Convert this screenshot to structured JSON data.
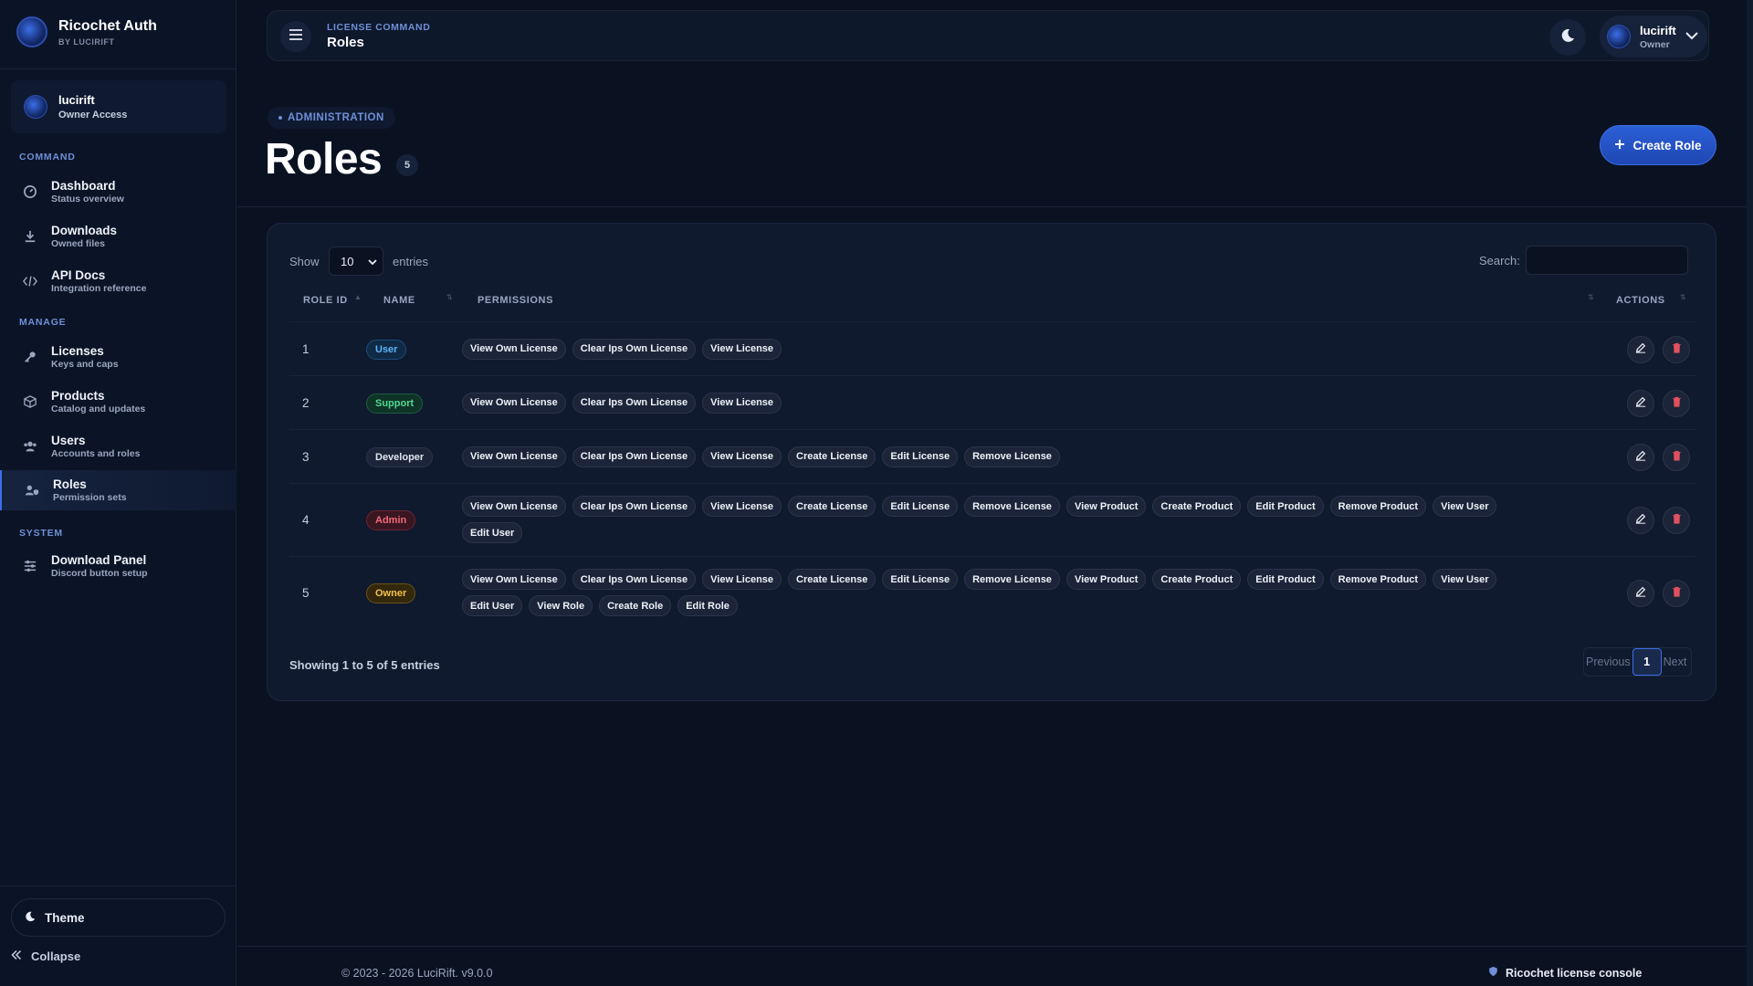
{
  "app": {
    "title": "Ricochet Auth",
    "subtitle": "BY LUCIRIFT"
  },
  "user": {
    "name": "lucirift",
    "access": "Owner Access"
  },
  "sidebar": {
    "sections": [
      {
        "label": "COMMAND"
      },
      {
        "label": "MANAGE"
      },
      {
        "label": "SYSTEM"
      }
    ],
    "items": [
      {
        "title": "Dashboard",
        "sub": "Status overview",
        "icon": "gauge-icon"
      },
      {
        "title": "Downloads",
        "sub": "Owned files",
        "icon": "download-icon"
      },
      {
        "title": "API Docs",
        "sub": "Integration reference",
        "icon": "code-icon"
      },
      {
        "title": "Licenses",
        "sub": "Keys and caps",
        "icon": "key-icon"
      },
      {
        "title": "Products",
        "sub": "Catalog and updates",
        "icon": "box-icon"
      },
      {
        "title": "Users",
        "sub": "Accounts and roles",
        "icon": "users-icon"
      },
      {
        "title": "Roles",
        "sub": "Permission sets",
        "icon": "user-shield-icon"
      },
      {
        "title": "Download Panel",
        "sub": "Discord button setup",
        "icon": "sliders-icon"
      }
    ],
    "theme_label": "Theme",
    "collapse_label": "Collapse"
  },
  "topbar": {
    "breadcrumb_top": "LICENSE COMMAND",
    "breadcrumb_main": "Roles",
    "profile_name": "lucirift",
    "profile_role": "Owner"
  },
  "header": {
    "section_pill": "ADMINISTRATION",
    "title": "Roles",
    "count": "5",
    "create_label": "Create Role"
  },
  "table": {
    "show_label": "Show",
    "page_size": "10",
    "entries_label": "entries",
    "search_label": "Search:",
    "search_value": "",
    "columns": [
      "ROLE ID",
      "NAME",
      "PERMISSIONS",
      "ACTIONS"
    ],
    "rows": [
      {
        "id": "1",
        "name": "User",
        "permissions": [
          "View Own License",
          "Clear Ips Own License",
          "View License"
        ]
      },
      {
        "id": "2",
        "name": "Support",
        "permissions": [
          "View Own License",
          "Clear Ips Own License",
          "View License"
        ]
      },
      {
        "id": "3",
        "name": "Developer",
        "permissions": [
          "View Own License",
          "Clear Ips Own License",
          "View License",
          "Create License",
          "Edit License",
          "Remove License"
        ]
      },
      {
        "id": "4",
        "name": "Admin",
        "permissions": [
          "View Own License",
          "Clear Ips Own License",
          "View License",
          "Create License",
          "Edit License",
          "Remove License",
          "View Product",
          "Create Product",
          "Edit Product",
          "Remove Product",
          "View User",
          "Edit User"
        ]
      },
      {
        "id": "5",
        "name": "Owner",
        "permissions": [
          "View Own License",
          "Clear Ips Own License",
          "View License",
          "Create License",
          "Edit License",
          "Remove License",
          "View Product",
          "Create Product",
          "Edit Product",
          "Remove Product",
          "View User",
          "Edit User",
          "View Role",
          "Create Role",
          "Edit Role"
        ]
      }
    ],
    "showing": "Showing 1 to 5 of 5 entries",
    "pager": {
      "prev": "Previous",
      "current": "1",
      "next": "Next"
    }
  },
  "role_colors": {
    "User": {
      "bg": "#0f2a45",
      "fg": "#5db4f5",
      "border": "#1e4d7a"
    },
    "Support": {
      "bg": "#0f3326",
      "fg": "#4fd891",
      "border": "#1d5c42"
    },
    "Developer": {
      "bg": "#1b2438",
      "fg": "#dfe5f0",
      "border": "#2a344b"
    },
    "Admin": {
      "bg": "#3a1620",
      "fg": "#f16a7c",
      "border": "#6a2533"
    },
    "Owner": {
      "bg": "#33270c",
      "fg": "#f3c24a",
      "border": "#6a5216"
    }
  },
  "footer": {
    "copyright": "© 2023 - 2026 LuciRift. v9.0.0",
    "right_label": "Ricochet license console"
  }
}
